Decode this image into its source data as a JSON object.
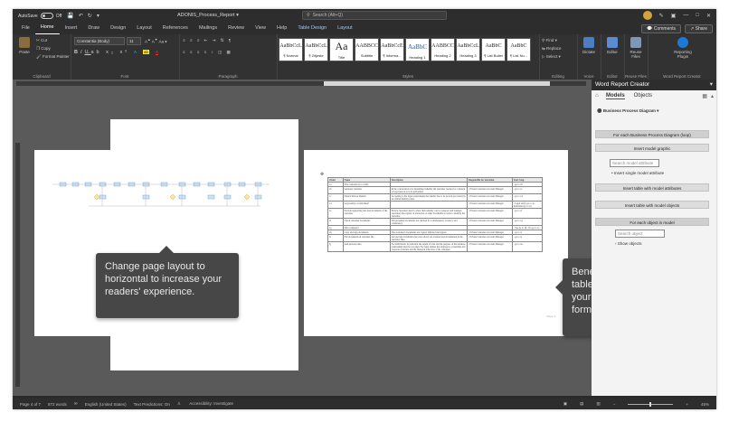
{
  "titlebar": {
    "autosave_label": "AutoSave",
    "autosave_state": "Off",
    "doc_title": "ADONIS_Process_Report",
    "search_placeholder": "Search (Alt+Q)"
  },
  "menu": {
    "tabs": [
      "File",
      "Home",
      "Insert",
      "Draw",
      "Design",
      "Layout",
      "References",
      "Mailings",
      "Review",
      "View",
      "Help",
      "Table Design",
      "Layout"
    ],
    "active_index": 1,
    "comments_label": "Comments",
    "share_label": "Share"
  },
  "ribbon": {
    "clipboard": {
      "paste": "Paste",
      "cut": "Cut",
      "copy": "Copy",
      "format_painter": "Format Painter",
      "label": "Clipboard"
    },
    "font": {
      "name": "Constantia (Body)",
      "size": "11",
      "label": "Font"
    },
    "paragraph": {
      "label": "Paragraph"
    },
    "styles": {
      "label": "Styles",
      "items": [
        {
          "preview": "AaBbCcL",
          "name": "¶ Normal"
        },
        {
          "preview": "AaBbCcL",
          "name": "¶ Zitjeste"
        },
        {
          "preview": "Aa",
          "name": "Title"
        },
        {
          "preview": "AABBCC",
          "name": "Subtitle"
        },
        {
          "preview": "AaBbCcE",
          "name": "¶ Informa..."
        },
        {
          "preview": "AaBbC",
          "name": "Heading 1"
        },
        {
          "preview": "AABBCC",
          "name": "Heading 2"
        },
        {
          "preview": "AaBbCcL",
          "name": "Heading 3"
        },
        {
          "preview": "AaBbC",
          "name": "¶ List Bullet"
        },
        {
          "preview": "AaBbC",
          "name": "¶ List Nu..."
        }
      ]
    },
    "editing": {
      "find": "Find",
      "replace": "Replace",
      "select": "Select",
      "label": "Editing"
    },
    "voice": {
      "dictate": "Dictate",
      "label": "Voice"
    },
    "editor": {
      "btn": "Editor",
      "label": "Editor"
    },
    "reuse": {
      "btn": "Reuse Files",
      "label": "Reuse Files"
    },
    "reporting": {
      "btn": "Reporting Plugin",
      "label": "Word Report Creator"
    }
  },
  "doc": {
    "callout_left": "Change page layout to horizontal to increase your readers' experience.",
    "callout_right": "Benefit from easy to use table creators. Document your process flow in textual form.",
    "page_footer": "Page 3",
    "table_headers": [
      "Order",
      "Name",
      "Description",
      "Responsible for execution",
      "Start-Stop"
    ],
    "table_rows": [
      [
        "1a",
        "New customer is to verify",
        "",
        "",
        "- go to 1b"
      ],
      [
        "1b",
        "Generate customer",
        "In the conversation it is determined whether the customer reaches for a natural or legal person is to be performed.",
        "- Private Customer Account Manager",
        "- go to 1c"
      ],
      [
        "1c",
        "Natural Person Identity",
        "According to the legal requirements the identity has to be proved (recorded) by an official identity paper.",
        "- Private Customer Account Manager",
        "- go to 1d"
      ],
      [
        "1d",
        "Legal entity or individual?",
        "",
        "- Private Customer Account Manager",
        "- Legal entity go to 1e  - Individual go to 1g"
      ],
      [
        "1e",
        "Provide supporting data and documents of the customer",
        "Private customers need to show their identity card or passport and business customers the register of extraction or other documents in order to identify the customer.",
        "- Private Customer Account Manager",
        "- go to 1f"
      ],
      [
        "1f",
        "Check customer documents",
        "The presented documents are checked for completeness, accuracy and consistency.",
        "- Private Customer Account Manager",
        "- go to 1g"
      ],
      [
        "1g",
        "Data complete?",
        "",
        "",
        "- Yes go to 1h  - No go to 1e"
      ],
      [
        "1h",
        "Copy and sign documents",
        "The customer's documents are copied, initialed and signed.",
        "- Private Customer Account Manager",
        "- go to 1i"
      ],
      [
        "1i",
        "File documents in customer file",
        "All relevant documents that were shown are scanned and documented in the customer files.",
        "- Private Customer Account Manager",
        "- go to 1j"
      ],
      [
        "1j",
        "Add personal data",
        "For individuals, in particular the extent of trust and the purpose of the business relationship must be recorded. For legal entities the employees, ownership and corporate structure and the financial reflection of the customer.",
        "- Private Customer Account Manager",
        "- go to 1k"
      ]
    ]
  },
  "pane": {
    "title": "Word Report Creator",
    "tabs": [
      "Models",
      "Objects"
    ],
    "active_tab": 0,
    "model_type": "Business Process Diagram",
    "for_each_model": "For each Business Process Diagram (loop)",
    "insert_graphic": "Insert model graphic",
    "search_attr_placeholder": "Search model attribute",
    "insert_single_attr": "Insert single model attribute",
    "insert_table_attrs": "Insert table with model attributes",
    "insert_table_objs": "Insert table with model objects",
    "for_each_object": "For each object in model",
    "search_object_placeholder": "Search object",
    "show_objects": "Show objects"
  },
  "status": {
    "page": "Page 4 of 7",
    "words": "872 words",
    "language": "English (United States)",
    "text_predictions": "Text Predictions: On",
    "accessibility": "Accessibility: Investigate",
    "zoom": "45%"
  }
}
